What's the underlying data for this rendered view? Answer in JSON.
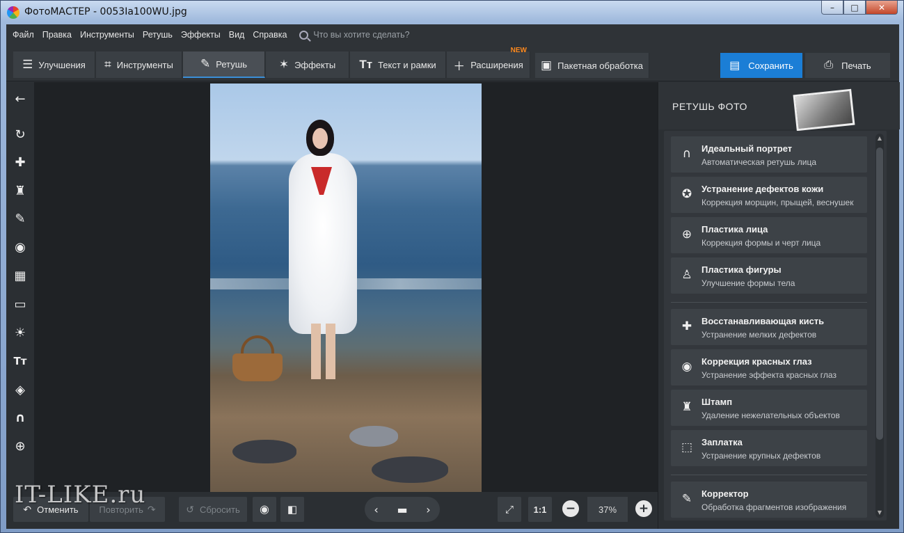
{
  "window": {
    "title": "ФотоМАСТЕР - 0053Ia100WU.jpg",
    "controls": {
      "minimize": "–",
      "maximize": "□",
      "close": "✕"
    }
  },
  "menu": {
    "items": [
      "Файл",
      "Правка",
      "Инструменты",
      "Ретушь",
      "Эффекты",
      "Вид",
      "Справка"
    ],
    "search_placeholder": "Что вы хотите сделать?"
  },
  "toolbar": {
    "tabs": [
      {
        "label": "Улучшения",
        "icon": "sliders-icon"
      },
      {
        "label": "Инструменты",
        "icon": "crop-icon"
      },
      {
        "label": "Ретушь",
        "icon": "brush-icon",
        "active": true
      },
      {
        "label": "Эффекты",
        "icon": "magic-wand-icon"
      },
      {
        "label": "Текст и рамки",
        "icon": "text-icon"
      },
      {
        "label": "Расширения",
        "icon": "plus-icon",
        "badge": "NEW"
      },
      {
        "label": "Пакетная обработка",
        "icon": "images-icon"
      }
    ],
    "save_label": "Сохранить",
    "print_label": "Печать",
    "accent_color": "#1b7ed6",
    "badge_color": "#ff8a1e"
  },
  "left_tools": [
    {
      "name": "back-arrow-icon",
      "glyph": "←"
    },
    {
      "name": "rotate-icon",
      "glyph": "↻"
    },
    {
      "name": "bandage-icon",
      "glyph": "✚"
    },
    {
      "name": "stamp-icon",
      "glyph": "♜"
    },
    {
      "name": "brush-icon",
      "glyph": "✎"
    },
    {
      "name": "radial-icon",
      "glyph": "◉"
    },
    {
      "name": "gradient-icon",
      "glyph": "▦"
    },
    {
      "name": "vignette-icon",
      "glyph": "▭"
    },
    {
      "name": "sun-icon",
      "glyph": "☀"
    },
    {
      "name": "text-icon",
      "glyph": "Tт"
    },
    {
      "name": "fill-icon",
      "glyph": "◈"
    },
    {
      "name": "portrait-icon",
      "glyph": "∩"
    },
    {
      "name": "target-icon",
      "glyph": "⊕"
    }
  ],
  "bottom": {
    "undo": "Отменить",
    "redo": "Повторить",
    "reset": "Сбросить",
    "fit": "1:1",
    "zoom": "37%",
    "watermark": "IT-LIKE.ru"
  },
  "right_panel": {
    "title": "РЕТУШЬ ФОТО",
    "items": [
      {
        "title": "Идеальный портрет",
        "desc": "Автоматическая ретушь лица",
        "icon": "portrait-icon",
        "glyph": "∩"
      },
      {
        "title": "Устранение дефектов кожи",
        "desc": "Коррекция морщин, прыщей, веснушек",
        "icon": "skin-icon",
        "glyph": "✪"
      },
      {
        "title": "Пластика лица",
        "desc": "Коррекция формы и черт лица",
        "icon": "face-icon",
        "glyph": "⊕"
      },
      {
        "title": "Пластика фигуры",
        "desc": "Улучшение формы тела",
        "icon": "figure-icon",
        "glyph": "♙"
      },
      {
        "title": "Восстанавливающая кисть",
        "desc": "Устранение мелких дефектов",
        "icon": "bandage-icon",
        "glyph": "✚"
      },
      {
        "title": "Коррекция красных глаз",
        "desc": "Устранение эффекта красных глаз",
        "icon": "eye-icon",
        "glyph": "◉"
      },
      {
        "title": "Штамп",
        "desc": "Удаление нежелательных объектов",
        "icon": "stamp-icon",
        "glyph": "♜"
      },
      {
        "title": "Заплатка",
        "desc": "Устранение крупных дефектов",
        "icon": "patch-icon",
        "glyph": "⬚"
      },
      {
        "title": "Корректор",
        "desc": "Обработка фрагментов изображения",
        "icon": "brush-icon",
        "glyph": "✎"
      }
    ]
  }
}
